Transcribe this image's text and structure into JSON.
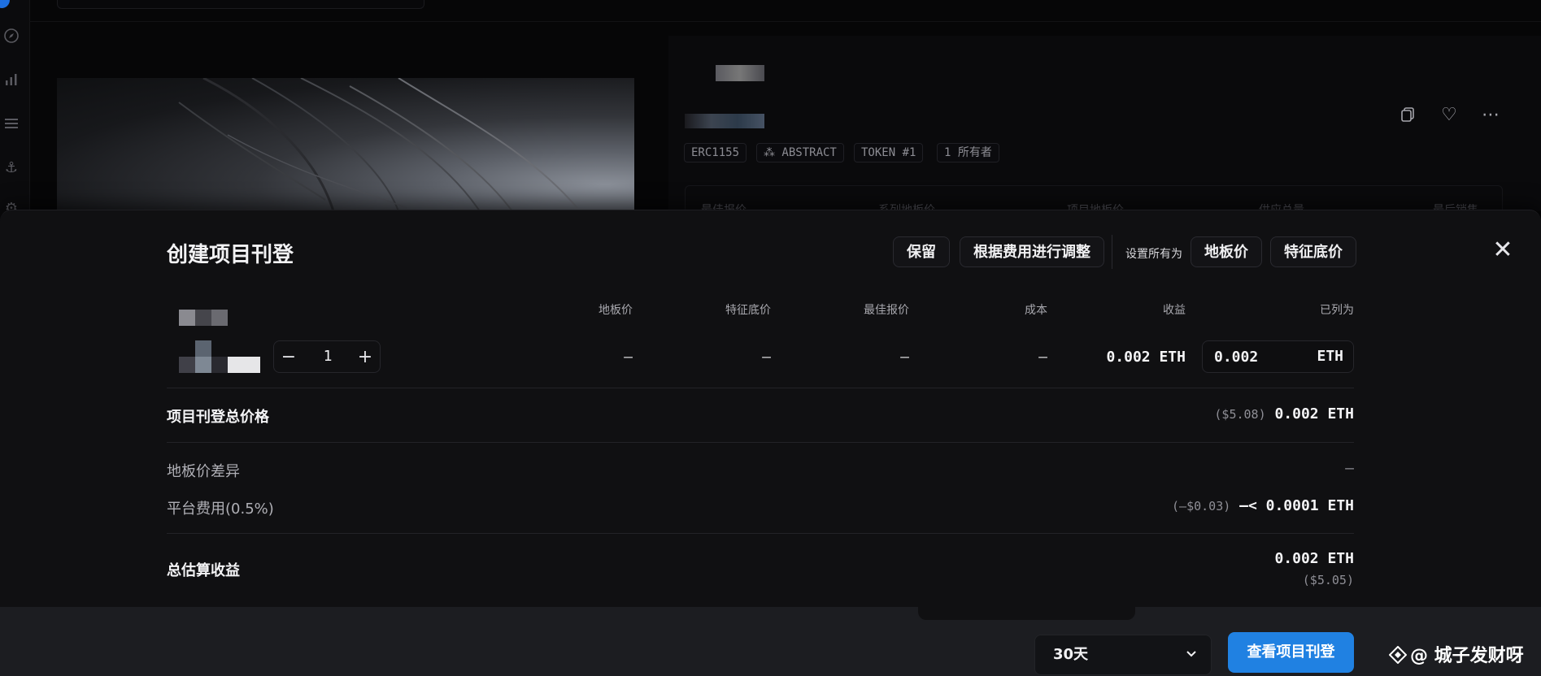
{
  "background": {
    "tags": [
      "ERC1155",
      "⁂ ABSTRACT",
      "TOKEN #1",
      "1 所有者"
    ],
    "stats_headers": [
      "最佳报价",
      "系列地板价",
      "项目地板价",
      "供应总量",
      "最后销售"
    ]
  },
  "modal": {
    "title": "创建项目刊登",
    "buttons": {
      "keep": "保留",
      "adjust_fees": "根据费用进行调整",
      "set_all_label": "设置所有为",
      "floor_price": "地板价",
      "trait_floor": "特征底价"
    },
    "columns": {
      "floor": "地板价",
      "trait_floor": "特征底价",
      "best_offer": "最佳报价",
      "cost": "成本",
      "proceeds": "收益",
      "listed_as": "已列为"
    },
    "item": {
      "quantity": "1",
      "floor": "–",
      "trait_floor": "–",
      "best_offer": "–",
      "cost": "–",
      "proceeds": "0.002 ETH",
      "listed_value": "0.002",
      "listed_unit": "ETH"
    },
    "summary": {
      "total_label": "项目刊登总价格",
      "total_usd": "($5.08)",
      "total_eth": "0.002 ETH",
      "floor_diff_label": "地板价差异",
      "floor_diff_value": "–",
      "fee_label": "平台费用(0.5%)",
      "fee_usd": "(–$0.03)",
      "fee_eth": "–< 0.0001 ETH",
      "est_label": "总估算收益",
      "est_eth": "0.002 ETH",
      "est_usd": "($5.05)"
    },
    "footer": {
      "duration": "30天",
      "review_button": "查看项目刊登"
    }
  },
  "watermark": "@ 城子发财呀",
  "colors": {
    "accent": "#2081e2",
    "background": "#060607",
    "modal": "#101012",
    "footer": "#1c1d21"
  }
}
